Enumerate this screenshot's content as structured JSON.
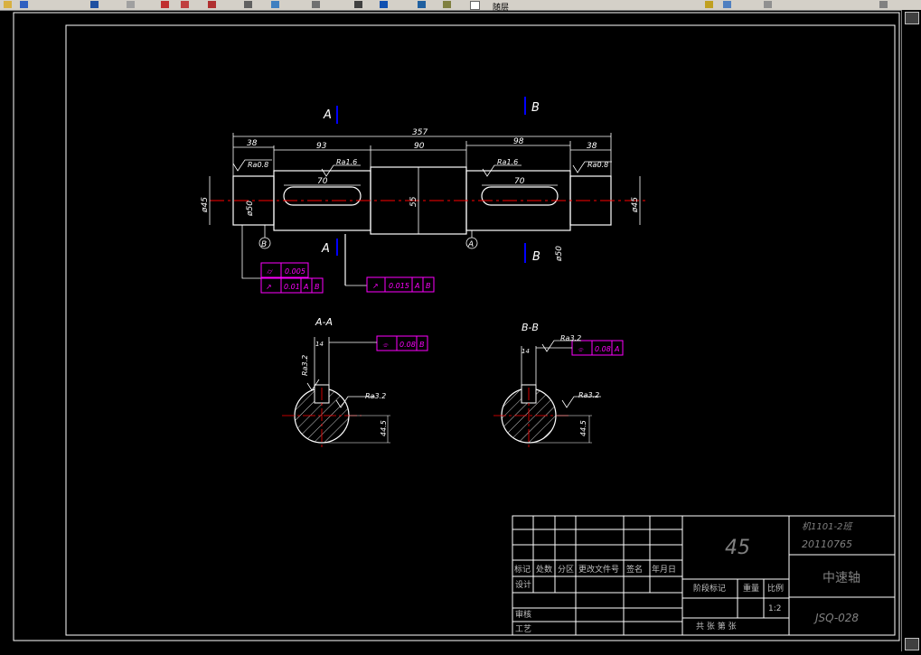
{
  "toolbar": {
    "icons": [
      "open-icon",
      "save-icon",
      "pan-icon",
      "zoom-icon",
      "zoom-window-icon",
      "zoom-previous-icon",
      "properties-icon",
      "text-style-icon",
      "layer-icon",
      "table-icon",
      "help-icon",
      "bulb-icon",
      "sun-icon",
      "lock-icon",
      "color-icon",
      "settings-icon"
    ],
    "layer_label": "随层"
  },
  "drawing": {
    "section_marks": {
      "a_top": "A",
      "b_top": "B",
      "a_bottom": "A",
      "b_bottom": "B"
    },
    "dimensions": {
      "total_length": "357",
      "left_step": "38",
      "left_key_section": "93",
      "middle": "90",
      "right_key_section": "98",
      "right_step": "38",
      "left_keyway": "70",
      "right_keyway": "70",
      "middle_dia": "55",
      "left_end_dia": "ø45",
      "right_end_dia": "ø45",
      "left_seat_dia": "ø50",
      "right_seat_dia": "ø50"
    },
    "roughness": {
      "left_end": "Ra0.8",
      "left_keyseat": "Ra1.6",
      "right_keyseat": "Ra1.6",
      "right_end": "Ra0.8",
      "aa_keyway_side": "Ra3.2",
      "aa_outer": "Ra3.2",
      "aa_left": "Ra3.2",
      "bb_keyway": "Ra3.2",
      "bb_outer": "Ra3.2"
    },
    "datums": {
      "left": "B",
      "right": "A"
    },
    "tolerance_frames": {
      "cylindricity": {
        "symbol": "⌭",
        "value": "0.005"
      },
      "runout_left": {
        "symbol": "↗",
        "value": "0.01",
        "ref1": "A",
        "ref2": "B"
      },
      "runout_mid": {
        "symbol": "↗",
        "value": "0.015",
        "ref1": "A",
        "ref2": "B"
      },
      "symmetry_aa": {
        "symbol": "⌯",
        "value": "0.08",
        "ref": "B"
      },
      "symmetry_bb": {
        "symbol": "⌯",
        "value": "0.08",
        "ref": "A"
      }
    },
    "sections": {
      "aa_title": "A-A",
      "bb_title": "B-B",
      "aa_key_width": "14",
      "bb_key_width": "14",
      "aa_depth": "44.5",
      "bb_depth": "44.5"
    }
  },
  "title_block": {
    "material": "45",
    "class_id": "机1101-2班",
    "student_no": "20110765",
    "part_name": "中速轴",
    "drawing_no": "JSQ-028",
    "headers": [
      "标记",
      "处数",
      "分区",
      "更改文件号",
      "签名",
      "年月日"
    ],
    "design": "设计",
    "review": "审核",
    "process": "工艺",
    "stage_mark": "阶段标记",
    "weight": "重量",
    "scale": "比例",
    "scale_value": "1:2",
    "sheets": "共 张  第 张"
  },
  "colors": {
    "outline": "#ffffff",
    "dimension": "#ffffff",
    "centerline": "#ff0000",
    "section_line": "#0000ff",
    "tolerance": "#ff00ff",
    "hatch": "#ffffff"
  }
}
